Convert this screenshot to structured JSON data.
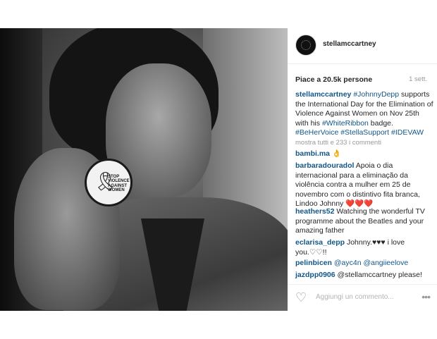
{
  "post": {
    "username": "stellamccartney",
    "likes_text": "Piace a 20.5k persone",
    "time_ago": "1 sett.",
    "caption": {
      "username": "stellamccartney",
      "parts": [
        {
          "tag": "#JohnnyDepp"
        },
        {
          "text": " supports the International Day for the Elimination of Violence Against Women on Nov 25th with his "
        },
        {
          "tag": "#WhiteRibbon"
        },
        {
          "text": " badge. "
        },
        {
          "tag": "#BeHerVoice #StellaSupport #IDEVAW"
        }
      ]
    },
    "show_all_comments": "mostra tutti e 233 i commenti",
    "badge_text": "STOP VIOLENCE AGAINST WOMEN"
  },
  "comments": [
    {
      "username": "bambi.ma",
      "text": "👌"
    },
    {
      "username": "barbaradouradol",
      "text": "Apoia o dia internacional para a eliminação da violência contra a mulher em 25 de novembro com o distintivo fita branca, Lindoo Johnny ",
      "hearts": "❤️❤️❤️"
    },
    {
      "username": "heathers52",
      "text": "Watching the wonderful TV programme about the Beatles and your amazing father"
    },
    {
      "username": "eclarisa_depp",
      "text": "Johnny.♥♥♥ i love you.♡♡!!"
    },
    {
      "username": "pelinbicen",
      "text": "@ayc4n @angiieelove"
    },
    {
      "username": "jazdpp0906",
      "text": "@stellamccartney please!"
    }
  ],
  "footer": {
    "add_comment_placeholder": "Aggiungi un commento...",
    "like_icon": "heart-outline-icon",
    "more_icon": "more-options-icon"
  },
  "colors": {
    "link": "#125688",
    "muted": "#999999"
  }
}
